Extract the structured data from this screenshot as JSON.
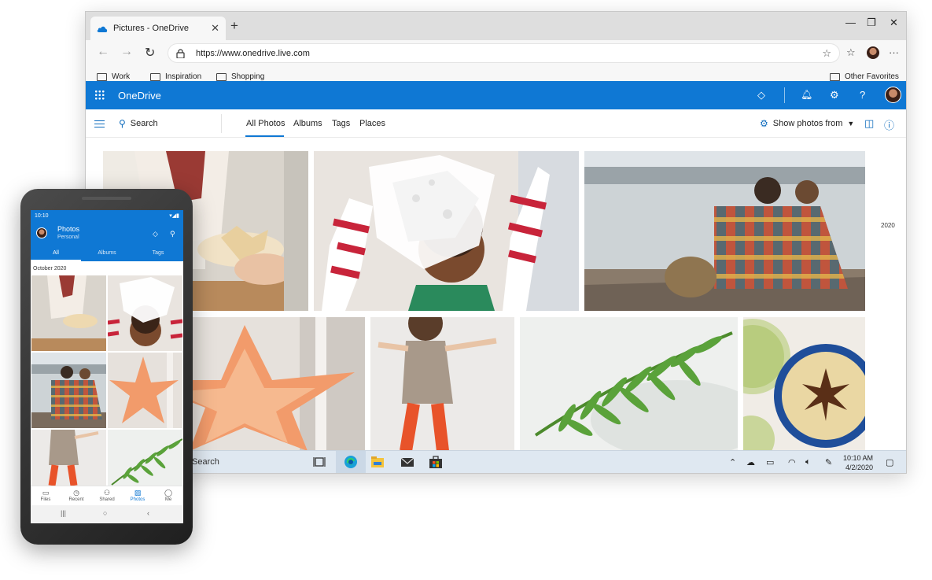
{
  "browser": {
    "tab_title": "Pictures - OneDrive",
    "tab_close": "✕",
    "new_tab": "+",
    "controls": {
      "minimize": "—",
      "restore": "❐",
      "close": "✕"
    },
    "nav": {
      "back": "←",
      "forward": "→",
      "refresh": "↻"
    },
    "url": "https://www.onedrive.live.com",
    "favorites": [
      "Work",
      "Inspiration",
      "Shopping"
    ],
    "other_favorites": "Other Favorites",
    "icons": {
      "star": "☆",
      "collections": "☆",
      "more": "···"
    }
  },
  "onedrive": {
    "app_name": "OneDrive",
    "header_icons": {
      "premium": "◇",
      "bell": "🔔︎",
      "settings": "⚙",
      "help": "?"
    },
    "search_label": "Search",
    "tabs": [
      "All Photos",
      "Albums",
      "Tags",
      "Places"
    ],
    "active_tab": "All Photos",
    "show_from_label": "Show photos from",
    "year_label": "2020",
    "cmd_icons": {
      "layout": "◫",
      "info": "ⓘ"
    }
  },
  "taskbar": {
    "search_text": "Search",
    "time": "10:10 AM",
    "date": "4/2/2020"
  },
  "phone": {
    "time": "10:10",
    "signal": "▾◢▮",
    "title": "Photos",
    "subtitle": "Personal",
    "tabs": [
      "All",
      "Albums",
      "Tags"
    ],
    "date_label": "October 2020",
    "nav": [
      {
        "label": "Files",
        "icon": "▭"
      },
      {
        "label": "Recent",
        "icon": "◷"
      },
      {
        "label": "Shared",
        "icon": "⚇"
      },
      {
        "label": "Photos",
        "icon": "▨"
      },
      {
        "label": "Me",
        "icon": "◯"
      }
    ],
    "active_nav": "Photos",
    "sys_buttons": {
      "recents": "|||",
      "home": "○",
      "back": "‹"
    }
  },
  "colors": {
    "accent": "#0f78d4",
    "tab_underline": "#0f78d4",
    "taskbar": "#dfe8f1"
  }
}
